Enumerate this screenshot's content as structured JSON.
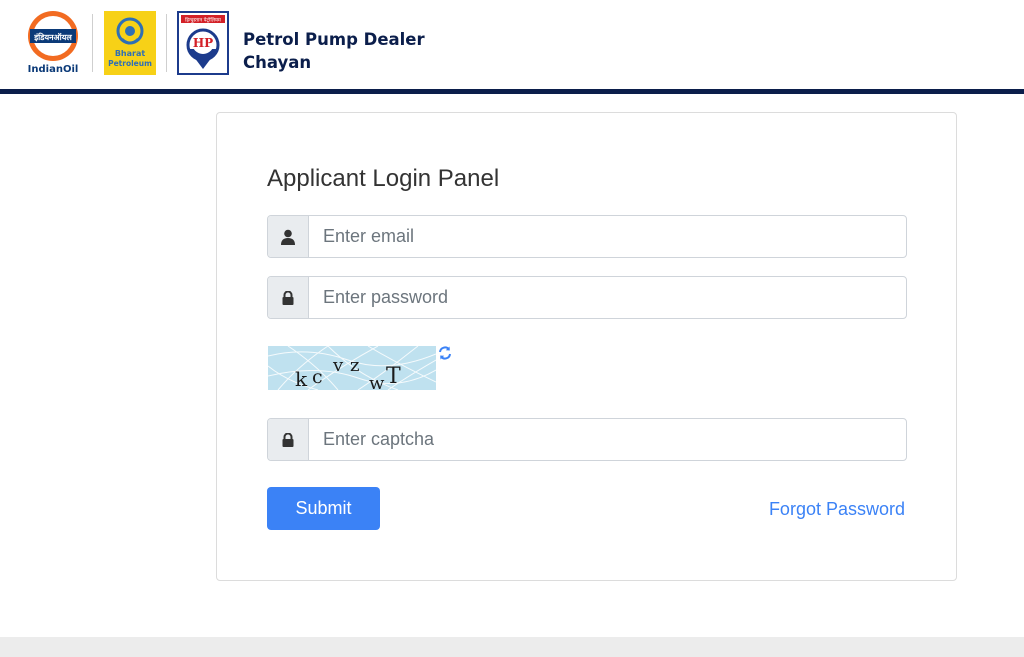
{
  "header": {
    "logos": {
      "indianoil": {
        "name": "IndianOil",
        "script_text": "इंडियनऑयल",
        "color": "#f26b21",
        "navy": "#0b3a78"
      },
      "bharat_petroleum": {
        "line1": "Bharat",
        "line2": "Petroleum",
        "color": "#f7d117",
        "blue": "#2f6fb5"
      },
      "hp": {
        "top_text": "हिन्दुस्तान पेट्रोलियम",
        "letters": "HP",
        "red": "#d32027",
        "navy": "#1c3b8c"
      }
    },
    "brand_line1": "Petrol Pump Dealer",
    "brand_line2": "Chayan",
    "bar_color": "#0b1e4b"
  },
  "login": {
    "title": "Applicant Login Panel",
    "email_placeholder": "Enter email",
    "password_placeholder": "Enter password",
    "captcha_placeholder": "Enter captcha",
    "captcha_chars": [
      "k",
      "c",
      "v",
      "z",
      "w",
      "T"
    ],
    "submit_label": "Submit",
    "forgot_label": "Forgot Password",
    "icons": {
      "email": "user-icon",
      "password": "lock-icon",
      "captcha": "lock-icon",
      "refresh": "refresh-icon"
    },
    "accent": "#3b82f6"
  }
}
